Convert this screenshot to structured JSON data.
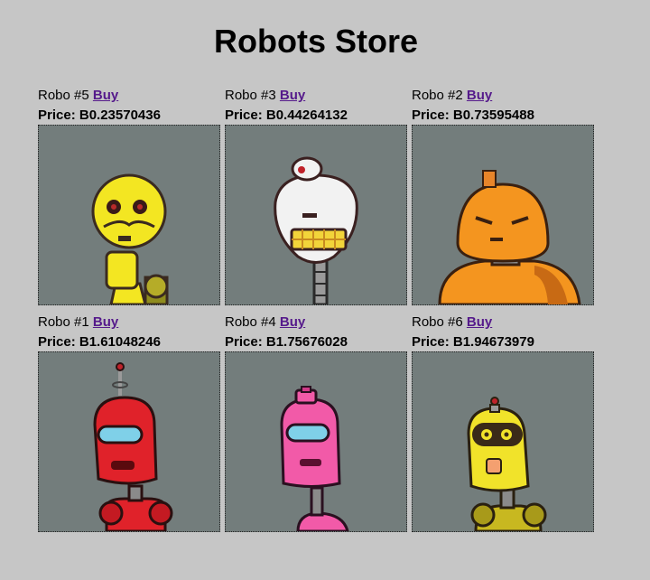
{
  "page": {
    "title": "Robots Store"
  },
  "robots": [
    {
      "name": "Robo #5",
      "buy_label": "Buy",
      "price": "Price: B0.23570436",
      "color": "#f3e622"
    },
    {
      "name": "Robo #3",
      "buy_label": "Buy",
      "price": "Price: B0.44264132",
      "color": "#f2f2f2"
    },
    {
      "name": "Robo #2",
      "buy_label": "Buy",
      "price": "Price: B0.73595488",
      "color": "#f4951f"
    },
    {
      "name": "Robo #1",
      "buy_label": "Buy",
      "price": "Price: B1.61048246",
      "color": "#e0222a"
    },
    {
      "name": "Robo #4",
      "buy_label": "Buy",
      "price": "Price: B1.75676028",
      "color": "#f25aa8"
    },
    {
      "name": "Robo #6",
      "buy_label": "Buy",
      "price": "Price: B1.94673979",
      "color": "#f1e32a"
    }
  ]
}
